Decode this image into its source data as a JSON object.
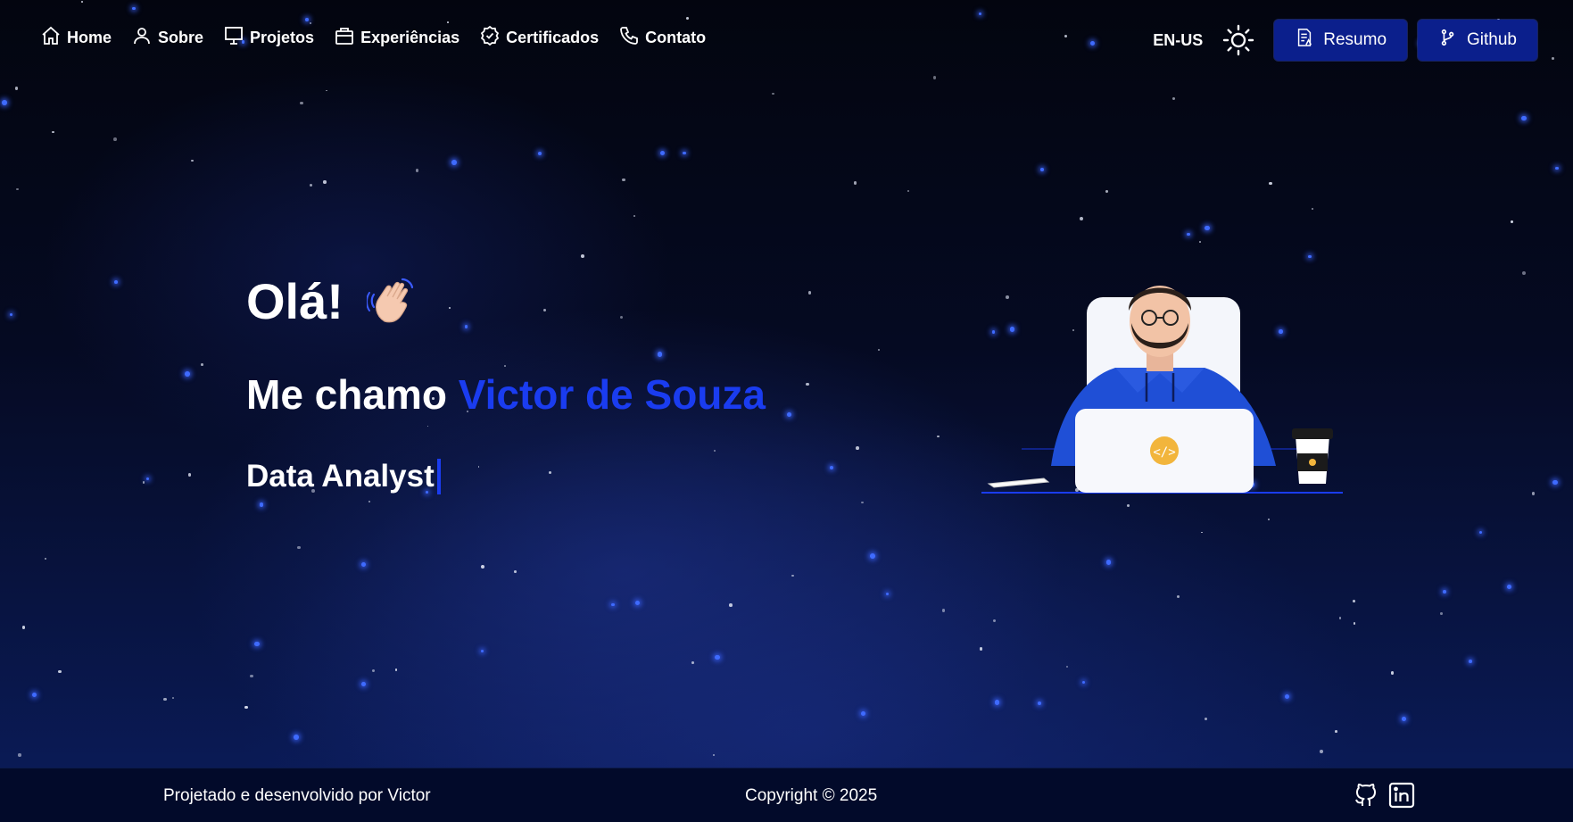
{
  "nav": {
    "items": [
      {
        "label": "Home",
        "icon": "home-icon"
      },
      {
        "label": "Sobre",
        "icon": "user-icon"
      },
      {
        "label": "Projetos",
        "icon": "monitor-icon"
      },
      {
        "label": "Experiências",
        "icon": "briefcase-icon"
      },
      {
        "label": "Certificados",
        "icon": "badge-check-icon"
      },
      {
        "label": "Contato",
        "icon": "phone-icon"
      }
    ],
    "language": "EN-US",
    "theme_icon": "sun-icon",
    "resume_label": "Resumo",
    "github_label": "Github"
  },
  "hero": {
    "greeting": "Olá!",
    "greeting_icon": "waving-hand-icon",
    "name_prefix": "Me chamo ",
    "name": "Victor de Souza",
    "role": "Data Analyst"
  },
  "footer": {
    "designed_by": "Projetado e desenvolvido por Victor",
    "copyright": "Copyright © 2025",
    "social_icons": [
      "github-icon",
      "linkedin-icon"
    ]
  },
  "colors": {
    "accent": "#1a3cf0",
    "button_bg": "#0b1f8c",
    "footer_bg": "#020a2a"
  }
}
